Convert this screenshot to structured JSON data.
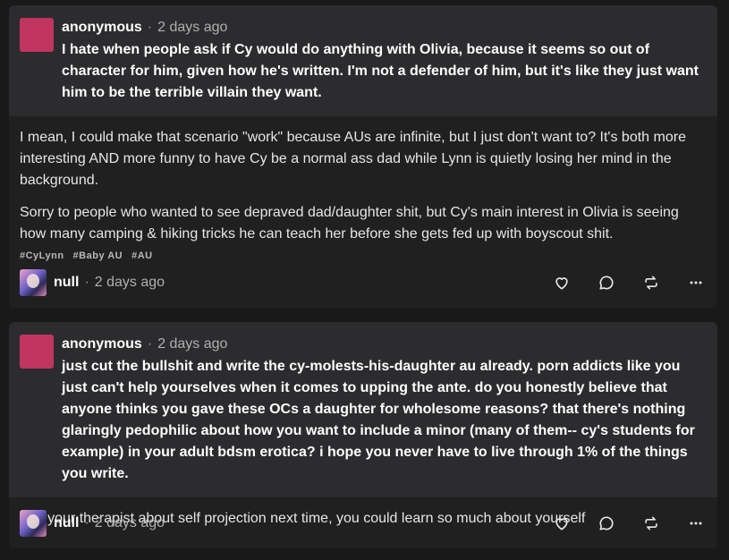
{
  "posts": [
    {
      "ask": {
        "asker": "anonymous",
        "separator": "·",
        "time": "2 days ago",
        "text": "I hate when people ask if Cy would do anything with Olivia, because it seems so out of character for him, given how he's written. I'm not a defender of him, but it's like they just want him to be the terrible villain they want."
      },
      "answer": [
        "I mean, I could make that scenario \"work\" because AUs are infinite, but I just don't want to? It's both more interesting AND more funny to have Cy be a normal ass dad while Lynn is quietly losing her mind in the background.",
        "Sorry to people who wanted to see depraved dad/daughter shit, but Cy's main interest in Olivia is seeing how many camping & hiking tricks he can teach her before she gets fed up with boyscout shit."
      ],
      "tags": [
        "#CyLynn",
        "#Baby AU",
        "#AU"
      ],
      "author": {
        "name": "null",
        "separator": "·",
        "time": "2 days ago"
      }
    },
    {
      "ask": {
        "asker": "anonymous",
        "separator": "·",
        "time": "2 days ago",
        "text": "just cut the bullshit and write the cy-molests-his-daughter au already. porn addicts like you just can't help yourselves when it comes to upping the ante. do you honestly believe that anyone thinks you gave these OCs a daughter for wholesome reasons? that there's nothing glaringly pedophilic about how you want to include a minor (many of them-- cy's students for example) in your adult bdsm erotica? i hope you never have to live through 1% of the things you write."
      },
      "answer": [
        "Ask your therapist about self projection next time, you could learn so much about yourself"
      ],
      "author": {
        "name": "null",
        "separator": "·",
        "time": "2 days ago"
      }
    }
  ],
  "icons": [
    "heart-icon",
    "comment-icon",
    "reblog-icon",
    "more-icon"
  ],
  "colors": {
    "page_bg": "#191919",
    "card_bg": "#202020",
    "ask_bg": "#2c2c2f",
    "asker_avatar": "#c03560"
  }
}
